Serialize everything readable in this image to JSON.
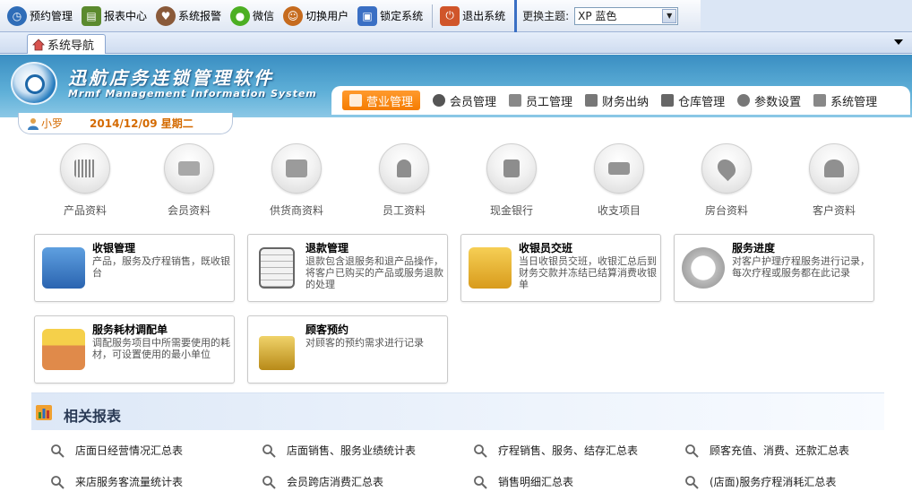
{
  "toolbar": {
    "items": [
      {
        "label": "预约管理",
        "icon": "clock-icon",
        "color": "#2f6db8"
      },
      {
        "label": "报表中心",
        "icon": "report-icon",
        "color": "#5b8a2e"
      },
      {
        "label": "系统报警",
        "icon": "heart-icon",
        "color": "#8a5a3a"
      },
      {
        "label": "微信",
        "icon": "wechat-icon",
        "color": "#4caf23"
      },
      {
        "label": "切换用户",
        "icon": "switch-user-icon",
        "color": "#c66b1e"
      },
      {
        "label": "锁定系统",
        "icon": "lock-icon",
        "color": "#3a6fc4"
      },
      {
        "label": "退出系统",
        "icon": "power-icon",
        "color": "#d0552a"
      }
    ],
    "theme_label": "更换主题:",
    "theme_value": "XP 蓝色"
  },
  "tabs": {
    "active": "系统导航"
  },
  "banner": {
    "title": "迅航店务连锁管理软件",
    "subtitle": "Mrmf Management Information System"
  },
  "mainnav": [
    {
      "label": "营业管理",
      "icon": "business-icon",
      "active": true
    },
    {
      "label": "会员管理",
      "icon": "heart-icon",
      "active": false
    },
    {
      "label": "员工管理",
      "icon": "id-card-icon",
      "active": false
    },
    {
      "label": "财务出纳",
      "icon": "finance-icon",
      "active": false
    },
    {
      "label": "仓库管理",
      "icon": "cart-icon",
      "active": false
    },
    {
      "label": "参数设置",
      "icon": "gear-icon",
      "active": false
    },
    {
      "label": "系统管理",
      "icon": "wrench-icon",
      "active": false
    }
  ],
  "user": {
    "name": "小罗",
    "date": "2014/12/09 星期二"
  },
  "quick": [
    {
      "label": "产品资料",
      "icon": "barcode-icon"
    },
    {
      "label": "会员资料",
      "icon": "card-icon"
    },
    {
      "label": "供货商资料",
      "icon": "truck-icon"
    },
    {
      "label": "员工资料",
      "icon": "person-icon"
    },
    {
      "label": "现金银行",
      "icon": "book-icon"
    },
    {
      "label": "收支项目",
      "icon": "scale-icon"
    },
    {
      "label": "房台资料",
      "icon": "location-icon"
    },
    {
      "label": "客户资料",
      "icon": "customers-icon"
    }
  ],
  "cards": [
    {
      "title": "收银管理",
      "desc": "产品，服务及疗程销售，既收银台",
      "icon": "cash-register-icon",
      "color": "#3b7fc9"
    },
    {
      "title": "退款管理",
      "desc": "退款包含退服务和退产品操作，将客户已购买的产品或服务退款的处理",
      "icon": "refund-icon",
      "color": "#8c8c8c"
    },
    {
      "title": "收银员交班",
      "desc": "当日收银员交班，收银汇总后到财务交款并冻结已结算消费收银单",
      "icon": "folder-sync-icon",
      "color": "#e0a628"
    },
    {
      "title": "服务进度",
      "desc": "对客户护理疗程服务进行记录，每次疗程或服务都在此记录",
      "icon": "stopwatch-icon",
      "color": "#a0a0a0"
    },
    {
      "title": "服务耗材调配单",
      "desc": "调配服务项目中所需要使用的耗材，可设置使用的最小单位",
      "icon": "materials-icon",
      "color": "#d9864a"
    },
    {
      "title": "顾客预约",
      "desc": "对顾客的预约需求进行记录",
      "icon": "padlock-icon",
      "color": "#c9a227"
    }
  ],
  "reports": {
    "title": "相关报表",
    "items": [
      "店面日经营情况汇总表",
      "店面销售、服务业绩统计表",
      "疗程销售、服务、结存汇总表",
      "顾客充值、消费、还款汇总表",
      "来店服务客流量统计表",
      "会员跨店消费汇总表",
      "销售明细汇总表",
      "(店面)服务疗程消耗汇总表"
    ]
  }
}
